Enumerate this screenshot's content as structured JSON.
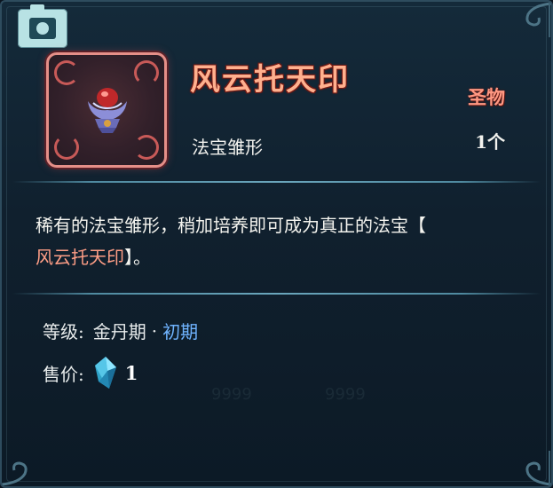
{
  "item": {
    "name": "风云托天印",
    "rarity": "圣物",
    "type": "法宝雏形",
    "count": "1个",
    "description_prefix": "稀有的法宝雏形，稍加培养即可成为真正的法宝【",
    "description_highlight": "风云托天印",
    "description_suffix": "】。"
  },
  "stats": {
    "level_label": "等级:",
    "realm": "金丹期",
    "separator": "·",
    "stage": "初期",
    "price_label": "售价:",
    "price_value": "1",
    "currency_icon": "crystal-icon"
  },
  "background_ghost": {
    "value_1": "9999",
    "value_2": "9999"
  },
  "colors": {
    "title": "#ffb08e",
    "rarity": "#ff9882",
    "stage": "#6fb4ff",
    "highlight": "#ff9e86",
    "frame": "#e58f88"
  }
}
